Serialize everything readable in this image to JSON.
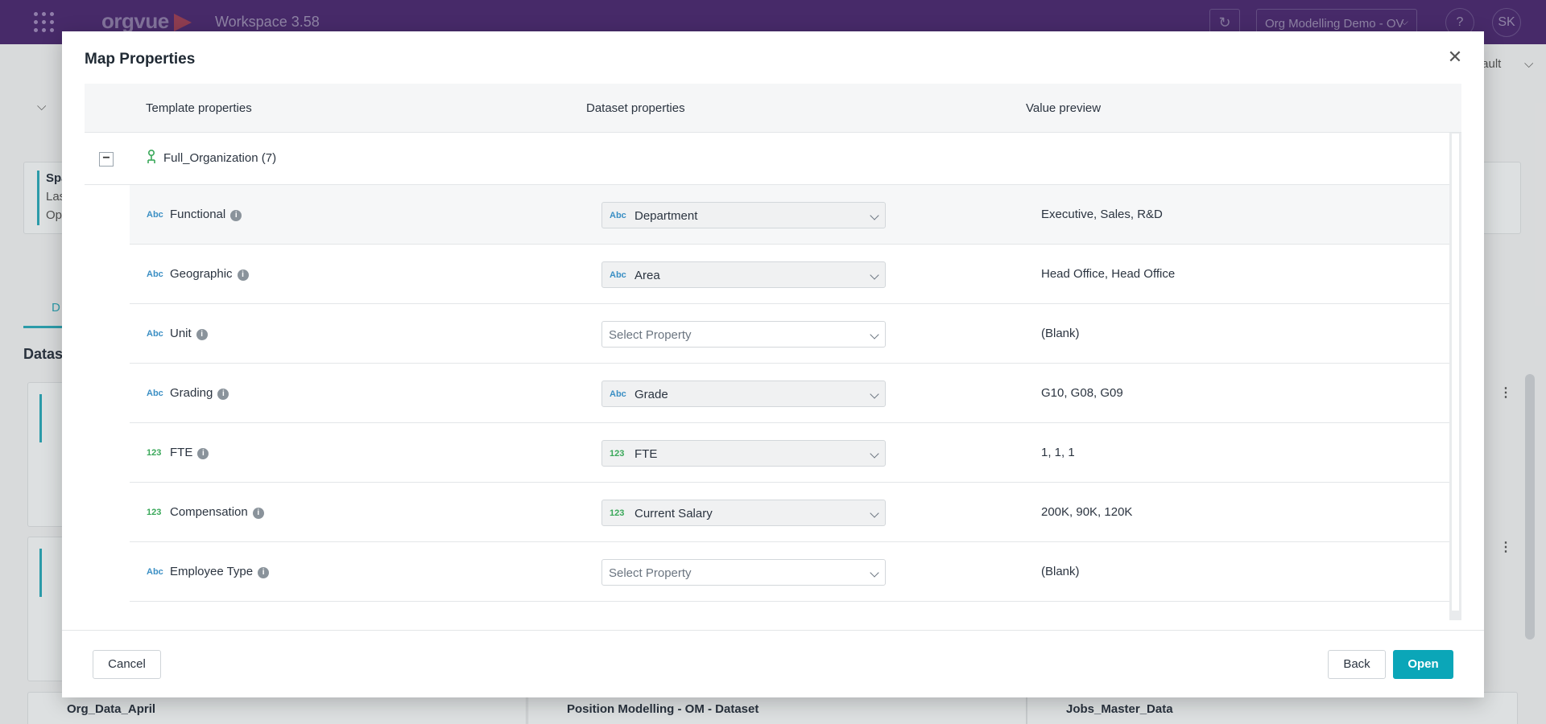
{
  "app": {
    "logo": "orgvue",
    "workspace_title": "Workspace  3.58",
    "workspace_selector": "Org Modelling Demo - OV",
    "help": "?",
    "avatar_initials": "SK"
  },
  "background": {
    "partial_text_right": "fault",
    "partial_left_1": "Spa",
    "partial_left_2": "Las",
    "partial_left_3": "Op",
    "partial_tab": "D",
    "partial_section": "Datas",
    "card_bottom_1": "Org_Data_April",
    "card_bottom_2": "Position Modelling - OM - Dataset",
    "card_bottom_3": "Jobs_Master_Data"
  },
  "modal": {
    "title": "Map Properties",
    "columns": [
      "Template properties",
      "Dataset properties",
      "Value preview"
    ],
    "group": {
      "label": "Full_Organization (7)",
      "collapse_symbol": "−"
    },
    "rows": [
      {
        "type": "Abc",
        "name": "Functional",
        "dataset_type": "Abc",
        "dataset_value": "Department",
        "preview": "Executive, Sales, R&D"
      },
      {
        "type": "Abc",
        "name": "Geographic",
        "dataset_type": "Abc",
        "dataset_value": "Area",
        "preview": "Head Office, Head Office"
      },
      {
        "type": "Abc",
        "name": "Unit",
        "dataset_type": "",
        "dataset_value": "Select Property",
        "preview": "(Blank)"
      },
      {
        "type": "Abc",
        "name": "Grading",
        "dataset_type": "Abc",
        "dataset_value": "Grade",
        "preview": "G10, G08, G09"
      },
      {
        "type": "123",
        "name": "FTE",
        "dataset_type": "123",
        "dataset_value": "FTE",
        "preview": "1, 1, 1"
      },
      {
        "type": "123",
        "name": "Compensation",
        "dataset_type": "123",
        "dataset_value": "Current Salary",
        "preview": "200K, 90K, 120K"
      },
      {
        "type": "Abc",
        "name": "Employee Type",
        "dataset_type": "",
        "dataset_value": "Select Property",
        "preview": "(Blank)"
      }
    ],
    "buttons": {
      "cancel": "Cancel",
      "back": "Back",
      "open": "Open"
    }
  },
  "colors": {
    "header": "#4b2b6f",
    "primary": "#0ba6b8",
    "text_type": "#3b8fc4",
    "number_type": "#3aa85a"
  }
}
